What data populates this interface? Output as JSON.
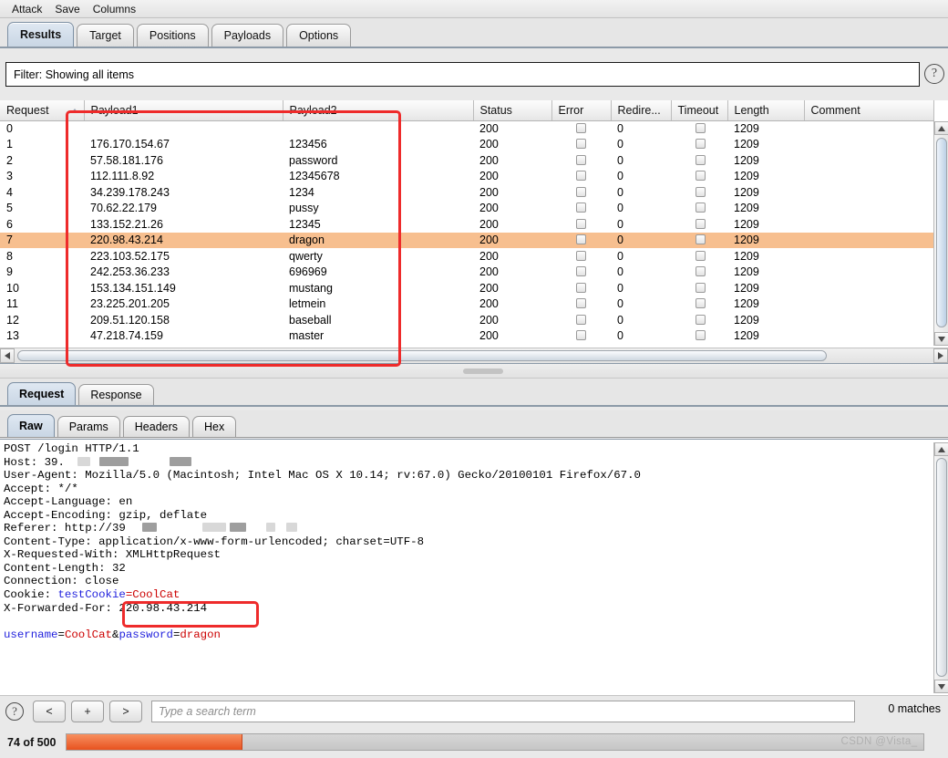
{
  "menu": {
    "items": [
      "Attack",
      "Save",
      "Columns"
    ]
  },
  "top_tabs": [
    {
      "label": "Results",
      "selected": true
    },
    {
      "label": "Target",
      "selected": false
    },
    {
      "label": "Positions",
      "selected": false
    },
    {
      "label": "Payloads",
      "selected": false
    },
    {
      "label": "Options",
      "selected": false
    }
  ],
  "filter": {
    "text": "Filter: Showing all items",
    "help_icon": "question-mark-icon"
  },
  "results_table": {
    "columns": [
      "Request",
      "Payload1",
      "Payload2",
      "Status",
      "Error",
      "Redire...",
      "Timeout",
      "Length",
      "Comment"
    ],
    "sort_column": "Request",
    "sort_direction": "ascending",
    "selected_row_index": 7,
    "highlight_color": "#f7bf8f",
    "rows": [
      {
        "request": "0",
        "payload1": "",
        "payload2": "",
        "status": "200",
        "error": false,
        "redirections": "0",
        "timeout": false,
        "length": "1209",
        "comment": ""
      },
      {
        "request": "1",
        "payload1": "176.170.154.67",
        "payload2": "123456",
        "status": "200",
        "error": false,
        "redirections": "0",
        "timeout": false,
        "length": "1209",
        "comment": ""
      },
      {
        "request": "2",
        "payload1": "57.58.181.176",
        "payload2": "password",
        "status": "200",
        "error": false,
        "redirections": "0",
        "timeout": false,
        "length": "1209",
        "comment": ""
      },
      {
        "request": "3",
        "payload1": "112.111.8.92",
        "payload2": "12345678",
        "status": "200",
        "error": false,
        "redirections": "0",
        "timeout": false,
        "length": "1209",
        "comment": ""
      },
      {
        "request": "4",
        "payload1": "34.239.178.243",
        "payload2": "1234",
        "status": "200",
        "error": false,
        "redirections": "0",
        "timeout": false,
        "length": "1209",
        "comment": ""
      },
      {
        "request": "5",
        "payload1": "70.62.22.179",
        "payload2": "pussy",
        "status": "200",
        "error": false,
        "redirections": "0",
        "timeout": false,
        "length": "1209",
        "comment": ""
      },
      {
        "request": "6",
        "payload1": "133.152.21.26",
        "payload2": "12345",
        "status": "200",
        "error": false,
        "redirections": "0",
        "timeout": false,
        "length": "1209",
        "comment": ""
      },
      {
        "request": "7",
        "payload1": "220.98.43.214",
        "payload2": "dragon",
        "status": "200",
        "error": false,
        "redirections": "0",
        "timeout": false,
        "length": "1209",
        "comment": ""
      },
      {
        "request": "8",
        "payload1": "223.103.52.175",
        "payload2": "qwerty",
        "status": "200",
        "error": false,
        "redirections": "0",
        "timeout": false,
        "length": "1209",
        "comment": ""
      },
      {
        "request": "9",
        "payload1": "242.253.36.233",
        "payload2": "696969",
        "status": "200",
        "error": false,
        "redirections": "0",
        "timeout": false,
        "length": "1209",
        "comment": ""
      },
      {
        "request": "10",
        "payload1": "153.134.151.149",
        "payload2": "mustang",
        "status": "200",
        "error": false,
        "redirections": "0",
        "timeout": false,
        "length": "1209",
        "comment": ""
      },
      {
        "request": "11",
        "payload1": "23.225.201.205",
        "payload2": "letmein",
        "status": "200",
        "error": false,
        "redirections": "0",
        "timeout": false,
        "length": "1209",
        "comment": ""
      },
      {
        "request": "12",
        "payload1": "209.51.120.158",
        "payload2": "baseball",
        "status": "200",
        "error": false,
        "redirections": "0",
        "timeout": false,
        "length": "1209",
        "comment": ""
      },
      {
        "request": "13",
        "payload1": "47.218.74.159",
        "payload2": "master",
        "status": "200",
        "error": false,
        "redirections": "0",
        "timeout": false,
        "length": "1209",
        "comment": ""
      }
    ]
  },
  "message_tabs": [
    {
      "label": "Request",
      "selected": true
    },
    {
      "label": "Response",
      "selected": false
    }
  ],
  "view_tabs": [
    {
      "label": "Raw",
      "selected": true
    },
    {
      "label": "Params",
      "selected": false
    },
    {
      "label": "Headers",
      "selected": false
    },
    {
      "label": "Hex",
      "selected": false
    }
  ],
  "request": {
    "request_line": "POST /login HTTP/1.1",
    "host_label": "Host: 39.",
    "user_agent": "User-Agent: Mozilla/5.0 (Macintosh; Intel Mac OS X 10.14; rv:67.0) Gecko/20100101 Firefox/67.0",
    "accept": "Accept: */*",
    "accept_language": "Accept-Language: en",
    "accept_encoding": "Accept-Encoding: gzip, deflate",
    "referer_label": "Referer: http://39",
    "content_type": "Content-Type: application/x-www-form-urlencoded; charset=UTF-8",
    "x_requested_with": "X-Requested-With: XMLHttpRequest",
    "content_length": "Content-Length: 32",
    "connection": "Connection: close",
    "cookie_label": "Cookie: ",
    "cookie_name": "testCookie",
    "cookie_eq": "=",
    "cookie_value": "CoolCat",
    "xff_label": "X-Forwarded-For: ",
    "xff_value": "220.98.43.214",
    "body_param1_name": "username",
    "body_param1_value": "CoolCat",
    "body_amp": "&",
    "body_param2_name": "password",
    "body_param2_value": "dragon"
  },
  "search": {
    "help_icon": "question-mark-icon",
    "prev_label": "<",
    "add_label": "+",
    "next_label": ">",
    "placeholder": "Type a search term",
    "value": "",
    "matches": "0 matches"
  },
  "status": {
    "progress_text": "74 of 500",
    "progress_percent": 20.6,
    "progress_color": "#e8521f",
    "watermark": "CSDN @Vista_"
  },
  "annotations": {
    "payload_columns_box_color": "#ee2b2b",
    "xff_box_color": "#ee2b2b"
  }
}
